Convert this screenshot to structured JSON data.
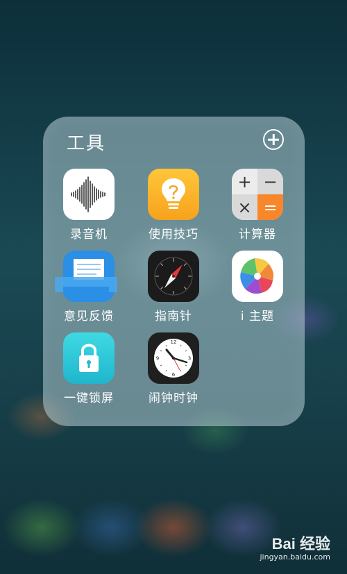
{
  "folder": {
    "title": "工具",
    "add_icon": "plus-circle-icon"
  },
  "apps": [
    {
      "label": "录音机",
      "icon": "voice-recorder-icon"
    },
    {
      "label": "使用技巧",
      "icon": "lightbulb-icon"
    },
    {
      "label": "计算器",
      "icon": "calculator-icon"
    },
    {
      "label": "意见反馈",
      "icon": "feedback-icon"
    },
    {
      "label": "指南针",
      "icon": "compass-icon"
    },
    {
      "label": "i 主题",
      "icon": "theme-pinwheel-icon"
    },
    {
      "label": "一键锁屏",
      "icon": "lock-icon"
    },
    {
      "label": "闹钟时钟",
      "icon": "clock-icon"
    }
  ],
  "calculator_keys": [
    "+",
    "−",
    "×",
    "="
  ],
  "watermark": {
    "logo": "Bai 经验",
    "url": "jingyan.baidu.com"
  }
}
